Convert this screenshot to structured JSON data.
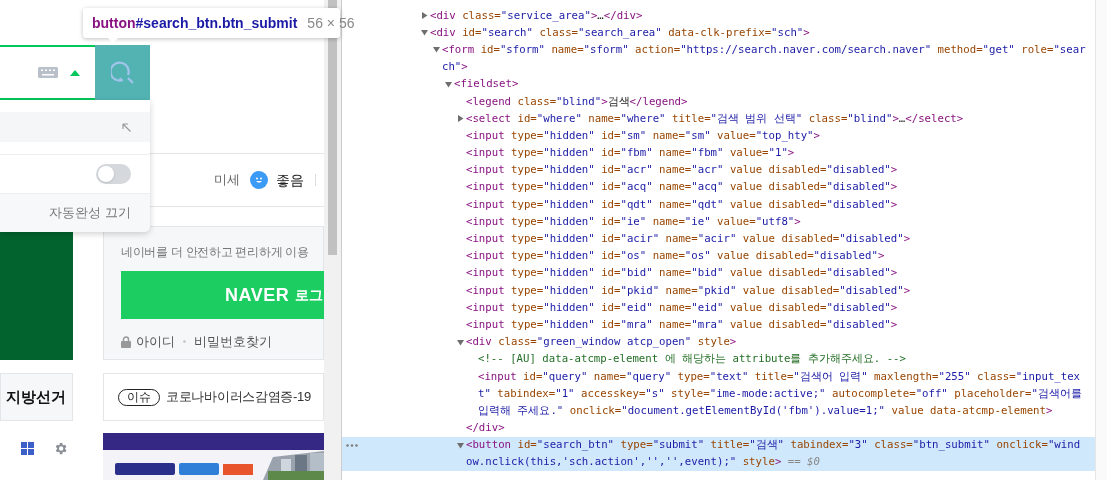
{
  "tooltip": {
    "tag": "button",
    "selector": "#search_btn.btn_submit",
    "size": "56 × 56"
  },
  "search": {
    "autocomplete_expanded": true
  },
  "autocomplete_panel": {
    "toggle": {
      "on": false
    },
    "footer_link": "자동완성 끄기"
  },
  "weather": {
    "label": "미세",
    "status": "좋음"
  },
  "login_box": {
    "message": "네이버를 더 안전하고 편리하게 이용",
    "button_brand": "NAVER",
    "button_label": "로그",
    "links": [
      "아이디",
      "비밀번호찾기"
    ]
  },
  "left_column": {
    "tab_label": "지방선거"
  },
  "issue": {
    "badge": "이슈",
    "headline": "코로나바이러스감염증-19"
  },
  "elements": [
    {
      "lines": [
        "<div class=\"service_area\">…</div>"
      ],
      "expanded": false,
      "selected": false
    },
    {
      "lines": [
        "<div id=\"search\" class=\"search_area\" data-clk-prefix=\"sch\">"
      ],
      "expanded": true,
      "selected": false,
      "children": [
        {
          "lines": [
            "<form id=\"sform\" name=\"sform\" action=\"https://search.naver.com/search.naver\" method=\"get\" role=\"sear",
            "ch\">"
          ],
          "expanded": true,
          "selected": false,
          "children": [
            {
              "lines": [
                "<fieldset>"
              ],
              "expanded": true,
              "selected": false,
              "children": [
                {
                  "lines": [
                    "<legend class=\"blind\">검색</legend>"
                  ],
                  "selected": false
                },
                {
                  "lines": [
                    "<select id=\"where\" name=\"where\" title=\"검색 범위 선택\" class=\"blind\">…</select>"
                  ],
                  "expanded": false,
                  "selected": false
                },
                {
                  "lines": [
                    "<input type=\"hidden\" id=\"sm\" name=\"sm\" value=\"top_hty\">"
                  ],
                  "selected": false
                },
                {
                  "lines": [
                    "<input type=\"hidden\" id=\"fbm\" name=\"fbm\" value=\"1\">"
                  ],
                  "selected": false
                },
                {
                  "lines": [
                    "<input type=\"hidden\" id=\"acr\" name=\"acr\" value disabled=\"disabled\">"
                  ],
                  "selected": false
                },
                {
                  "lines": [
                    "<input type=\"hidden\" id=\"acq\" name=\"acq\" value disabled=\"disabled\">"
                  ],
                  "selected": false
                },
                {
                  "lines": [
                    "<input type=\"hidden\" id=\"qdt\" name=\"qdt\" value disabled=\"disabled\">"
                  ],
                  "selected": false
                },
                {
                  "lines": [
                    "<input type=\"hidden\" id=\"ie\" name=\"ie\" value=\"utf8\">"
                  ],
                  "selected": false
                },
                {
                  "lines": [
                    "<input type=\"hidden\" id=\"acir\" name=\"acir\" value disabled=\"disabled\">"
                  ],
                  "selected": false
                },
                {
                  "lines": [
                    "<input type=\"hidden\" id=\"os\" name=\"os\" value disabled=\"disabled\">"
                  ],
                  "selected": false
                },
                {
                  "lines": [
                    "<input type=\"hidden\" id=\"bid\" name=\"bid\" value disabled=\"disabled\">"
                  ],
                  "selected": false
                },
                {
                  "lines": [
                    "<input type=\"hidden\" id=\"pkid\" name=\"pkid\" value disabled=\"disabled\">"
                  ],
                  "selected": false
                },
                {
                  "lines": [
                    "<input type=\"hidden\" id=\"eid\" name=\"eid\" value disabled=\"disabled\">"
                  ],
                  "selected": false
                },
                {
                  "lines": [
                    "<input type=\"hidden\" id=\"mra\" name=\"mra\" value disabled=\"disabled\">"
                  ],
                  "selected": false
                },
                {
                  "lines": [
                    "<div class=\"green_window atcp_open\" style>"
                  ],
                  "expanded": true,
                  "selected": false,
                  "closing": "</div>",
                  "children": [
                    {
                      "lines": [
                        "<!-- [AU] data-atcmp-element 에 해당하는 attribute를 추가해주세요. -->"
                      ],
                      "selected": false
                    },
                    {
                      "lines": [
                        "<input id=\"query\" name=\"query\" type=\"text\" title=\"검색어 입력\" maxlength=\"255\" class=\"input_tex",
                        "t\" tabindex=\"1\" accesskey=\"s\" style=\"ime-mode:active;\" autocomplete=\"off\" placeholder=\"검색어를",
                        "입력해 주세요.\" onclick=\"document.getElementById('fbm').value=1;\" value data-atcmp-element>"
                      ],
                      "selected": false
                    }
                  ]
                },
                {
                  "lines": [
                    "<button id=\"search_btn\" type=\"submit\" title=\"검색\" tabindex=\"3\" class=\"btn_submit\" onclick=\"wind",
                    "ow.nclick(this,'sch.action','','',event);\" style>"
                  ],
                  "expanded": true,
                  "selected": true,
                  "suffix": "== $0"
                }
              ]
            }
          ]
        }
      ]
    }
  ]
}
